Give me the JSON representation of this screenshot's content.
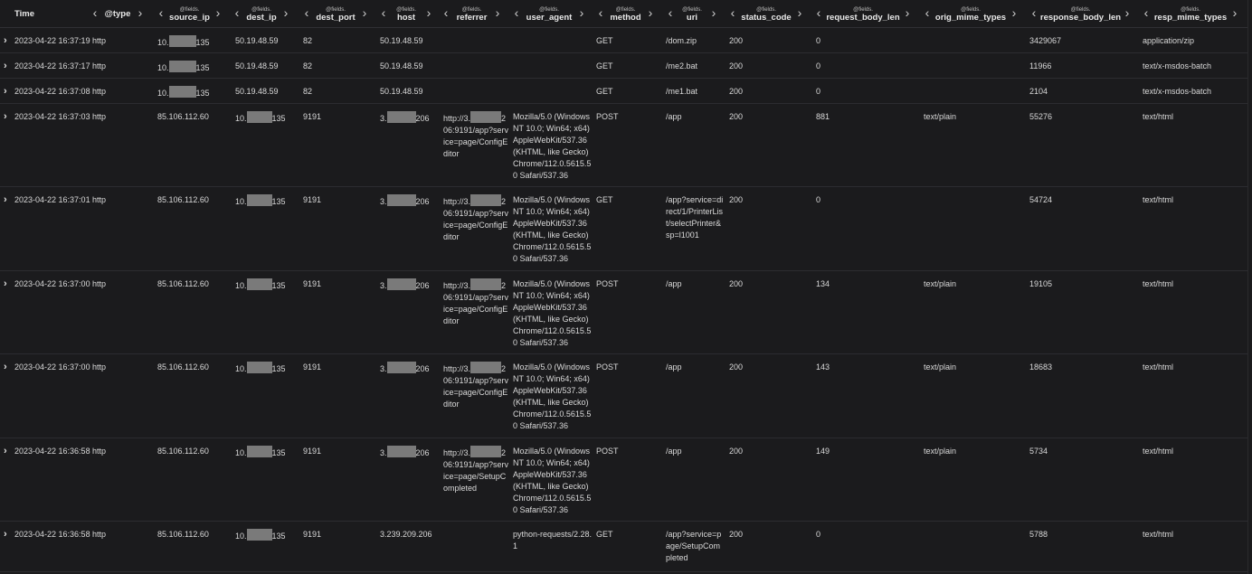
{
  "columns": [
    {
      "prefix": "",
      "name": "Time"
    },
    {
      "prefix": "",
      "name": "@type"
    },
    {
      "prefix": "@fields.",
      "name": "source_ip"
    },
    {
      "prefix": "@fields.",
      "name": "dest_ip"
    },
    {
      "prefix": "@fields.",
      "name": "dest_port"
    },
    {
      "prefix": "@fields.",
      "name": "host"
    },
    {
      "prefix": "@fields.",
      "name": "referrer"
    },
    {
      "prefix": "@fields.",
      "name": "user_agent"
    },
    {
      "prefix": "@fields.",
      "name": "method"
    },
    {
      "prefix": "@fields.",
      "name": "uri"
    },
    {
      "prefix": "@fields.",
      "name": "status_code"
    },
    {
      "prefix": "@fields.",
      "name": "request_body_len"
    },
    {
      "prefix": "@fields.",
      "name": "orig_mime_types"
    },
    {
      "prefix": "@fields.",
      "name": "response_body_len"
    },
    {
      "prefix": "@fields.",
      "name": "resp_mime_types"
    }
  ],
  "rows": [
    {
      "time": "2023-04-22 16:37:19",
      "type": "http",
      "source_ip": {
        "pre": "10.",
        "post": "135"
      },
      "dest_ip": "50.19.48.59",
      "dest_port": "82",
      "host": "50.19.48.59",
      "referrer": null,
      "user_agent": "",
      "method": "GET",
      "uri": "/dom.zip",
      "status_code": "200",
      "request_body_len": "0",
      "orig_mime_types": "",
      "response_body_len": "3429067",
      "resp_mime_types": "application/zip"
    },
    {
      "time": "2023-04-22 16:37:17",
      "type": "http",
      "source_ip": {
        "pre": "10.",
        "post": "135"
      },
      "dest_ip": "50.19.48.59",
      "dest_port": "82",
      "host": "50.19.48.59",
      "referrer": null,
      "user_agent": "",
      "method": "GET",
      "uri": "/me2.bat",
      "status_code": "200",
      "request_body_len": "0",
      "orig_mime_types": "",
      "response_body_len": "11966",
      "resp_mime_types": "text/x-msdos-batch"
    },
    {
      "time": "2023-04-22 16:37:08",
      "type": "http",
      "source_ip": {
        "pre": "10.",
        "post": "135"
      },
      "dest_ip": "50.19.48.59",
      "dest_port": "82",
      "host": "50.19.48.59",
      "referrer": null,
      "user_agent": "",
      "method": "GET",
      "uri": "/me1.bat",
      "status_code": "200",
      "request_body_len": "0",
      "orig_mime_types": "",
      "response_body_len": "2104",
      "resp_mime_types": "text/x-msdos-batch"
    },
    {
      "time": "2023-04-22 16:37:03",
      "type": "http",
      "source_ip": "85.106.112.60",
      "dest_ip": {
        "pre": "10.",
        "post": "135"
      },
      "dest_port": "9191",
      "host": {
        "pre": "3.",
        "post": "206"
      },
      "referrer": {
        "pre": "http://3.",
        "post": "2",
        "rest": "06:9191/app?service=page/ConfigEditor"
      },
      "user_agent": "Mozilla/5.0 (Windows NT 10.0; Win64; x64) AppleWebKit/537.36 (KHTML, like Gecko) Chrome/112.0.5615.50 Safari/537.36",
      "method": "POST",
      "uri": "/app",
      "status_code": "200",
      "request_body_len": "881",
      "orig_mime_types": "text/plain",
      "response_body_len": "55276",
      "resp_mime_types": "text/html"
    },
    {
      "time": "2023-04-22 16:37:01",
      "type": "http",
      "source_ip": "85.106.112.60",
      "dest_ip": {
        "pre": "10.",
        "post": "135"
      },
      "dest_port": "9191",
      "host": {
        "pre": "3.",
        "post": "206"
      },
      "referrer": {
        "pre": "http://3.",
        "post": "2",
        "rest": "06:9191/app?service=page/ConfigEditor"
      },
      "user_agent": "Mozilla/5.0 (Windows NT 10.0; Win64; x64) AppleWebKit/537.36 (KHTML, like Gecko) Chrome/112.0.5615.50 Safari/537.36",
      "method": "GET",
      "uri": "/app?service=direct/1/PrinterList/selectPrinter&sp=l1001",
      "status_code": "200",
      "request_body_len": "0",
      "orig_mime_types": "",
      "response_body_len": "54724",
      "resp_mime_types": "text/html"
    },
    {
      "time": "2023-04-22 16:37:00",
      "type": "http",
      "source_ip": "85.106.112.60",
      "dest_ip": {
        "pre": "10.",
        "post": "135"
      },
      "dest_port": "9191",
      "host": {
        "pre": "3.",
        "post": "206"
      },
      "referrer": {
        "pre": "http://3.",
        "post": "2",
        "rest": "06:9191/app?service=page/ConfigEditor"
      },
      "user_agent": "Mozilla/5.0 (Windows NT 10.0; Win64; x64) AppleWebKit/537.36 (KHTML, like Gecko) Chrome/112.0.5615.50 Safari/537.36",
      "method": "POST",
      "uri": "/app",
      "status_code": "200",
      "request_body_len": "134",
      "orig_mime_types": "text/plain",
      "response_body_len": "19105",
      "resp_mime_types": "text/html"
    },
    {
      "time": "2023-04-22 16:37:00",
      "type": "http",
      "source_ip": "85.106.112.60",
      "dest_ip": {
        "pre": "10.",
        "post": "135"
      },
      "dest_port": "9191",
      "host": {
        "pre": "3.",
        "post": "206"
      },
      "referrer": {
        "pre": "http://3.",
        "post": "2",
        "rest": "06:9191/app?service=page/ConfigEditor"
      },
      "user_agent": "Mozilla/5.0 (Windows NT 10.0; Win64; x64) AppleWebKit/537.36 (KHTML, like Gecko) Chrome/112.0.5615.50 Safari/537.36",
      "method": "POST",
      "uri": "/app",
      "status_code": "200",
      "request_body_len": "143",
      "orig_mime_types": "text/plain",
      "response_body_len": "18683",
      "resp_mime_types": "text/html"
    },
    {
      "time": "2023-04-22 16:36:58",
      "type": "http",
      "source_ip": "85.106.112.60",
      "dest_ip": {
        "pre": "10.",
        "post": "135"
      },
      "dest_port": "9191",
      "host": {
        "pre": "3.",
        "post": "206"
      },
      "referrer": {
        "pre": "http://3.",
        "post": "2",
        "rest": "06:9191/app?service=page/SetupCompleted"
      },
      "user_agent": "Mozilla/5.0 (Windows NT 10.0; Win64; x64) AppleWebKit/537.36 (KHTML, like Gecko) Chrome/112.0.5615.50 Safari/537.36",
      "method": "POST",
      "uri": "/app",
      "status_code": "200",
      "request_body_len": "149",
      "orig_mime_types": "text/plain",
      "response_body_len": "5734",
      "resp_mime_types": "text/html"
    },
    {
      "time": "2023-04-22 16:36:58",
      "type": "http",
      "source_ip": "85.106.112.60",
      "dest_ip": {
        "pre": "10.",
        "post": "135"
      },
      "dest_port": "9191",
      "host": "3.239.209.206",
      "referrer": null,
      "user_agent": "python-requests/2.28.1",
      "method": "GET",
      "uri": "/app?service=page/SetupCompleted",
      "status_code": "200",
      "request_body_len": "0",
      "orig_mime_types": "",
      "response_body_len": "5788",
      "resp_mime_types": "text/html"
    }
  ]
}
